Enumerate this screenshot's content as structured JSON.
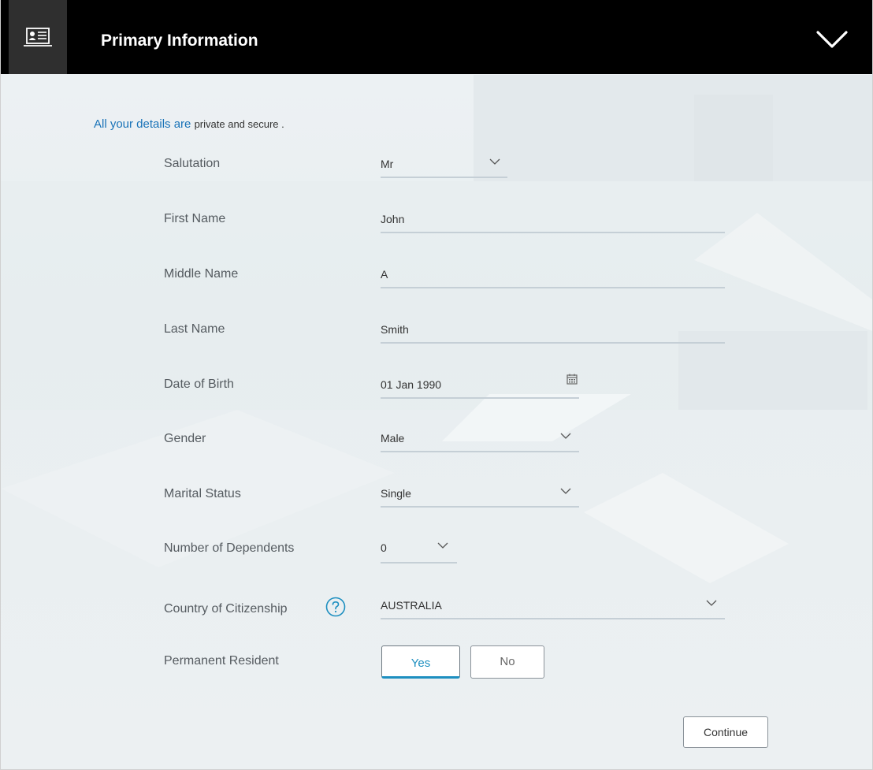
{
  "header": {
    "title": "Primary Information"
  },
  "privacy": {
    "lead": "All your details are",
    "rest": "private and secure ."
  },
  "form": {
    "salutation": {
      "label": "Salutation",
      "value": "Mr"
    },
    "first_name": {
      "label": "First Name",
      "value": "John"
    },
    "middle_name": {
      "label": "Middle Name",
      "value": "A"
    },
    "last_name": {
      "label": "Last Name",
      "value": "Smith"
    },
    "dob": {
      "label": "Date of Birth",
      "value": "01 Jan 1990"
    },
    "gender": {
      "label": "Gender",
      "value": "Male"
    },
    "marital_status": {
      "label": "Marital Status",
      "value": "Single"
    },
    "dependents": {
      "label": "Number of Dependents",
      "value": "0"
    },
    "citizenship": {
      "label": "Country of Citizenship",
      "value": "AUSTRALIA"
    },
    "permanent_resident": {
      "label": "Permanent Resident",
      "yes": "Yes",
      "no": "No",
      "selected": "Yes"
    }
  },
  "actions": {
    "continue_label": "Continue"
  },
  "colors": {
    "header_bg": "#000000",
    "accent": "#1d8fc0",
    "link_blue": "#1a73b8"
  }
}
